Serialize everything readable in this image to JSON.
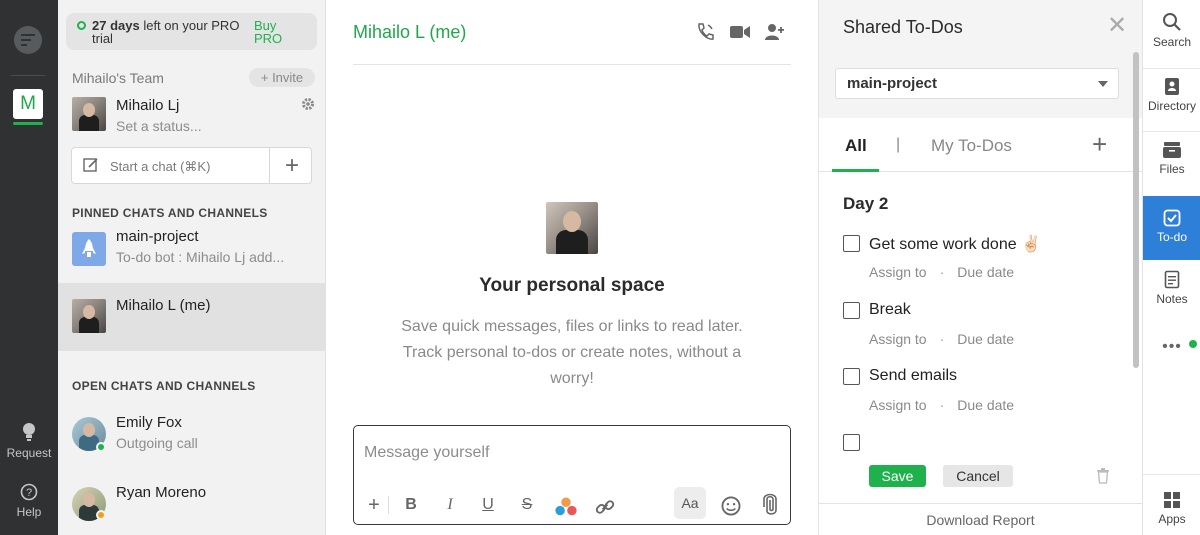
{
  "rail": {
    "workspace_letter": "M",
    "request_label": "Request",
    "help_label": "Help"
  },
  "sidebar": {
    "trial_days": "27 days",
    "trial_rest": "left on your PRO trial",
    "buy_label": "Buy PRO",
    "team_name": "Mihailo's Team",
    "invite_label": "+ Invite",
    "me_name": "Mihailo Lj",
    "me_status": "Set a status...",
    "start_chat_label": "Start a chat (⌘K)",
    "pinned_heading": "PINNED CHATS AND CHANNELS",
    "open_heading": "OPEN CHATS AND CHANNELS",
    "pinned": [
      {
        "title": "main-project",
        "sub": "To-do bot : Mihailo Lj add..."
      },
      {
        "title": "Mihailo L (me)",
        "sub": ""
      }
    ],
    "open": [
      {
        "title": "Emily Fox",
        "sub": "Outgoing call",
        "presence": "#1fb24c"
      },
      {
        "title": "Ryan Moreno",
        "sub": "",
        "presence": "#f0a020"
      }
    ]
  },
  "main": {
    "title": "Mihailo L (me)",
    "space_title": "Your personal space",
    "space_desc": "Save quick messages, files or links to read later. Track personal to-dos or create notes, without a worry!",
    "composer_placeholder": "Message yourself",
    "fmt_aa": "Aa"
  },
  "todo": {
    "title": "Shared To-Dos",
    "project": "main-project",
    "tab_all": "All",
    "tab_sep": "|",
    "tab_my": "My To-Dos",
    "day": "Day 2",
    "tasks": [
      {
        "name": "Get some work done ✌🏻",
        "assign": "Assign to",
        "due": "Due date"
      },
      {
        "name": "Break",
        "assign": "Assign to",
        "due": "Due date"
      },
      {
        "name": "Send emails",
        "assign": "Assign to",
        "due": "Due date"
      }
    ],
    "save_label": "Save",
    "cancel_label": "Cancel",
    "download_label": "Download Report"
  },
  "apps": {
    "search": "Search",
    "directory": "Directory",
    "files": "Files",
    "todo": "To-do",
    "notes": "Notes",
    "more": "•••",
    "apps": "Apps"
  },
  "colors": {
    "brand_green": "#1fb24c",
    "active_blue": "#2d7fd8",
    "rail_dark": "#2f3133"
  }
}
